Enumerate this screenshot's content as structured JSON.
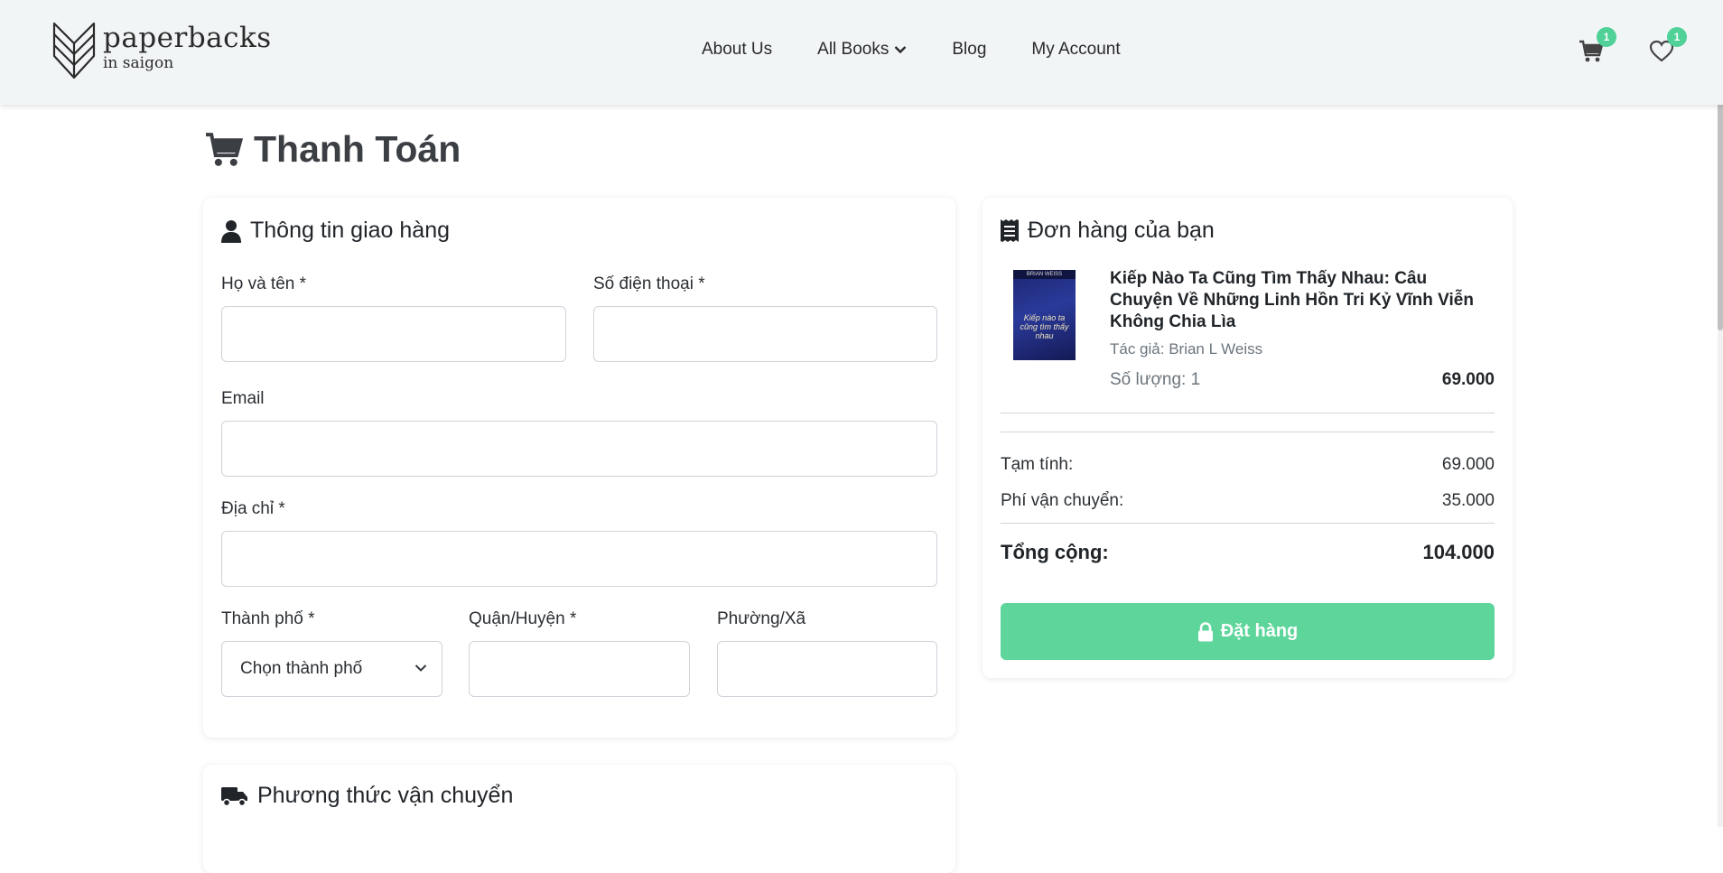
{
  "header": {
    "logo_main": "paperbacks",
    "logo_sub": "in saigon",
    "nav": [
      "About Us",
      "All Books",
      "Blog",
      "My Account"
    ],
    "cart_count": "1",
    "wishlist_count": "1"
  },
  "page": {
    "title": "Thanh Toán"
  },
  "shipping_info": {
    "title": "Thông tin giao hàng",
    "fullname_label": "Họ và tên *",
    "phone_label": "Số điện thoại *",
    "email_label": "Email",
    "address_label": "Địa chỉ *",
    "city_label": "Thành phố *",
    "city_value": "Chọn thành phố",
    "district_label": "Quận/Huyện *",
    "ward_label": "Phường/Xã"
  },
  "shipping_method": {
    "title": "Phương thức vận chuyển"
  },
  "order": {
    "title": "Đơn hàng của bạn",
    "item": {
      "title": "Kiếp Nào Ta Cũng Tìm Thấy Nhau: Câu Chuyện Về Những Linh Hồn Tri Kỷ Vĩnh Viễn Không Chia Lìa",
      "author": "Tác giả: Brian L Weiss",
      "quantity": "Số lượng: 1",
      "price": "69.000",
      "cover_author": "BRIAN WEISS",
      "cover_title": "Kiếp nào ta cũng tìm thấy nhau"
    },
    "subtotal_label": "Tạm tính:",
    "subtotal_value": "69.000",
    "shipping_label": "Phí vận chuyển:",
    "shipping_value": "35.000",
    "total_label": "Tổng cộng:",
    "total_value": "104.000",
    "place_order": "Đặt hàng"
  },
  "colors": {
    "accent": "#5dd59b",
    "badge": "#4fd198",
    "header_bg": "#f2f5f6"
  }
}
